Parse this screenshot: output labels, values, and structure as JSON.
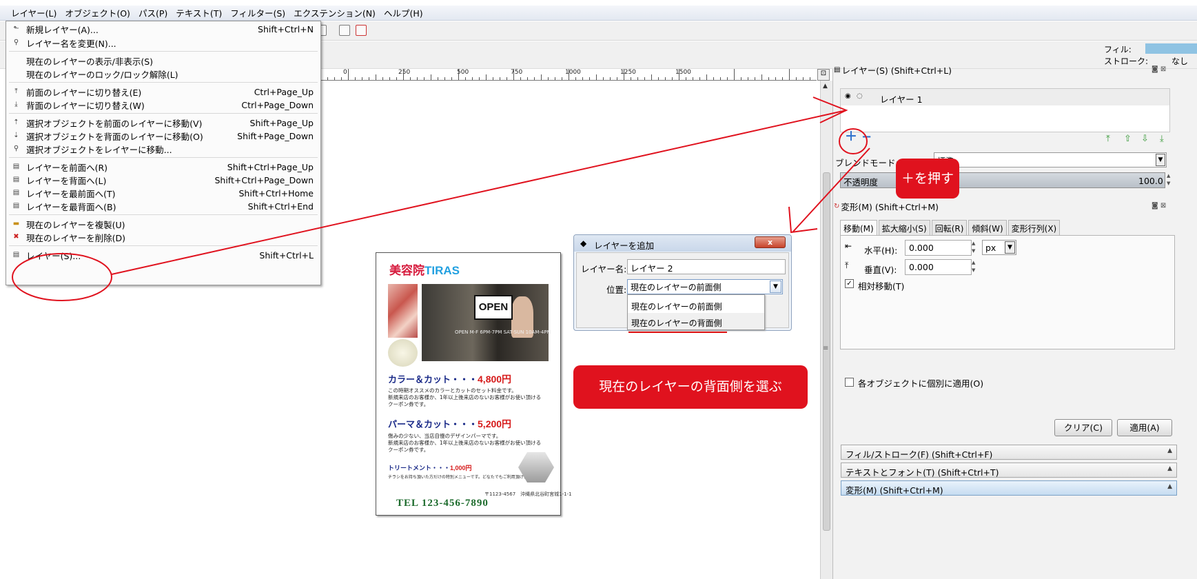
{
  "menubar": {
    "items": [
      "レイヤー(L)",
      "オブジェクト(O)",
      "パス(P)",
      "テキスト(T)",
      "フィルター(S)",
      "エクステンション(N)",
      "ヘルプ(H)"
    ]
  },
  "style_indicator": {
    "fill_label": "フィル:",
    "stroke_label": "ストローク:",
    "stroke_value": "なし",
    "fill_color": "#8fc3e3"
  },
  "ruler": {
    "labels": [
      "250",
      "0",
      "250",
      "500",
      "750",
      "1000",
      "1250",
      "1500"
    ]
  },
  "layer_menu": {
    "items": [
      {
        "label": "新規レイヤー(A)...",
        "shortcut": "Shift+Ctrl+N",
        "icon": "new-layer-icon"
      },
      {
        "label": "レイヤー名を変更(N)...",
        "shortcut": "",
        "icon": "rename-layer-icon"
      },
      {
        "label": "現在のレイヤーの表示/非表示(S)",
        "shortcut": "",
        "icon": ""
      },
      {
        "label": "現在のレイヤーのロック/ロック解除(L)",
        "shortcut": "",
        "icon": ""
      },
      {
        "label": "前面のレイヤーに切り替え(E)",
        "shortcut": "Ctrl+Page_Up",
        "icon": "switch-up-icon"
      },
      {
        "label": "背面のレイヤーに切り替え(W)",
        "shortcut": "Ctrl+Page_Down",
        "icon": "switch-down-icon"
      },
      {
        "label": "選択オブジェクトを前面のレイヤーに移動(V)",
        "shortcut": "Shift+Page_Up",
        "icon": "move-up-icon"
      },
      {
        "label": "選択オブジェクトを背面のレイヤーに移動(O)",
        "shortcut": "Shift+Page_Down",
        "icon": "move-down-icon"
      },
      {
        "label": "選択オブジェクトをレイヤーに移動...",
        "shortcut": "",
        "icon": "move-to-layer-icon"
      },
      {
        "label": "レイヤーを前面へ(R)",
        "shortcut": "Shift+Ctrl+Page_Up",
        "icon": "raise-icon"
      },
      {
        "label": "レイヤーを背面へ(L)",
        "shortcut": "Shift+Ctrl+Page_Down",
        "icon": "lower-icon"
      },
      {
        "label": "レイヤーを最前面へ(T)",
        "shortcut": "Shift+Ctrl+Home",
        "icon": "top-icon"
      },
      {
        "label": "レイヤーを最背面へ(B)",
        "shortcut": "Shift+Ctrl+End",
        "icon": "bottom-icon"
      },
      {
        "label": "現在のレイヤーを複製(U)",
        "shortcut": "",
        "icon": "duplicate-icon"
      },
      {
        "label": "現在のレイヤーを削除(D)",
        "shortcut": "",
        "icon": "delete-icon"
      },
      {
        "label": "レイヤー(S)...",
        "shortcut": "Shift+Ctrl+L",
        "icon": "layers-icon"
      }
    ]
  },
  "flyer": {
    "title_a": "美容院",
    "title_b": "TIRAS",
    "open_sign": "OPEN",
    "open_hours": "OPEN M-F 6PM-7PM SAT-SUN 10AM-4PM",
    "h1": "カラー＆カット・・・",
    "h1_price": "4,800円",
    "t1a": "この時期オススメのカラーとカットのセット料金です。",
    "t1b": "新規来店のお客様か、1年以上後来店のないお客様がお使い頂ける",
    "t1c": "クーポン券です。",
    "h2": "パーマ＆カット・・・",
    "h2_price": "5,200円",
    "t2a": "傷みの少ない、当店自慢のデザインパーマです。",
    "t2b": "新規来店のお客様か、1年以上後来店のないお客様がお使い頂ける",
    "t2c": "クーポン券です。",
    "h3": "トリートメント・・・",
    "h3_price": "1,000円",
    "t3": "チラシをお持ち頂いた方だけの特別メニューです。どなたでもご利用頂けます。",
    "address": "〒1123-4567　沖縄県北谷町宮城1-1-1",
    "tel": "TEL 123-456-7890"
  },
  "dialog": {
    "title": "レイヤーを追加",
    "close": "x",
    "name_label": "レイヤー名:",
    "name_value": "レイヤー 2",
    "position_label": "位置:",
    "position_value": "現在のレイヤーの前面側",
    "options": [
      "現在のレイヤーの前面側",
      "現在のレイヤーの背面側"
    ]
  },
  "layers_panel": {
    "title": "レイヤー(S) (Shift+Ctrl+L)",
    "layer_name": "レイヤー 1",
    "blend_label": "ブレンドモード:",
    "blend_value": "標準",
    "opacity_label": "不透明度",
    "opacity_value": "100.0"
  },
  "transform_panel": {
    "title": "変形(M) (Shift+Ctrl+M)",
    "tabs": [
      "移動(M)",
      "拡大縮小(S)",
      "回転(R)",
      "傾斜(W)",
      "変形行列(X)"
    ],
    "h_label": "水平(H):",
    "h_value": "0.000",
    "unit": "px",
    "v_label": "垂直(V):",
    "v_value": "0.000",
    "relative_label": "相対移動(T)",
    "relative_checked": "✓",
    "each_label": "各オブジェクトに個別に適用(O)",
    "clear": "クリア(C)",
    "apply": "適用(A)"
  },
  "collapsed_panels": [
    "フィル/ストローク(F) (Shift+Ctrl+F)",
    "テキストとフォント(T) (Shift+Ctrl+T)",
    "変形(M) (Shift+Ctrl+M)"
  ],
  "annotations": {
    "plus_callout": "＋を押す",
    "back_callout": "現在のレイヤーの背面側を選ぶ",
    "accent": "#e0121e"
  }
}
